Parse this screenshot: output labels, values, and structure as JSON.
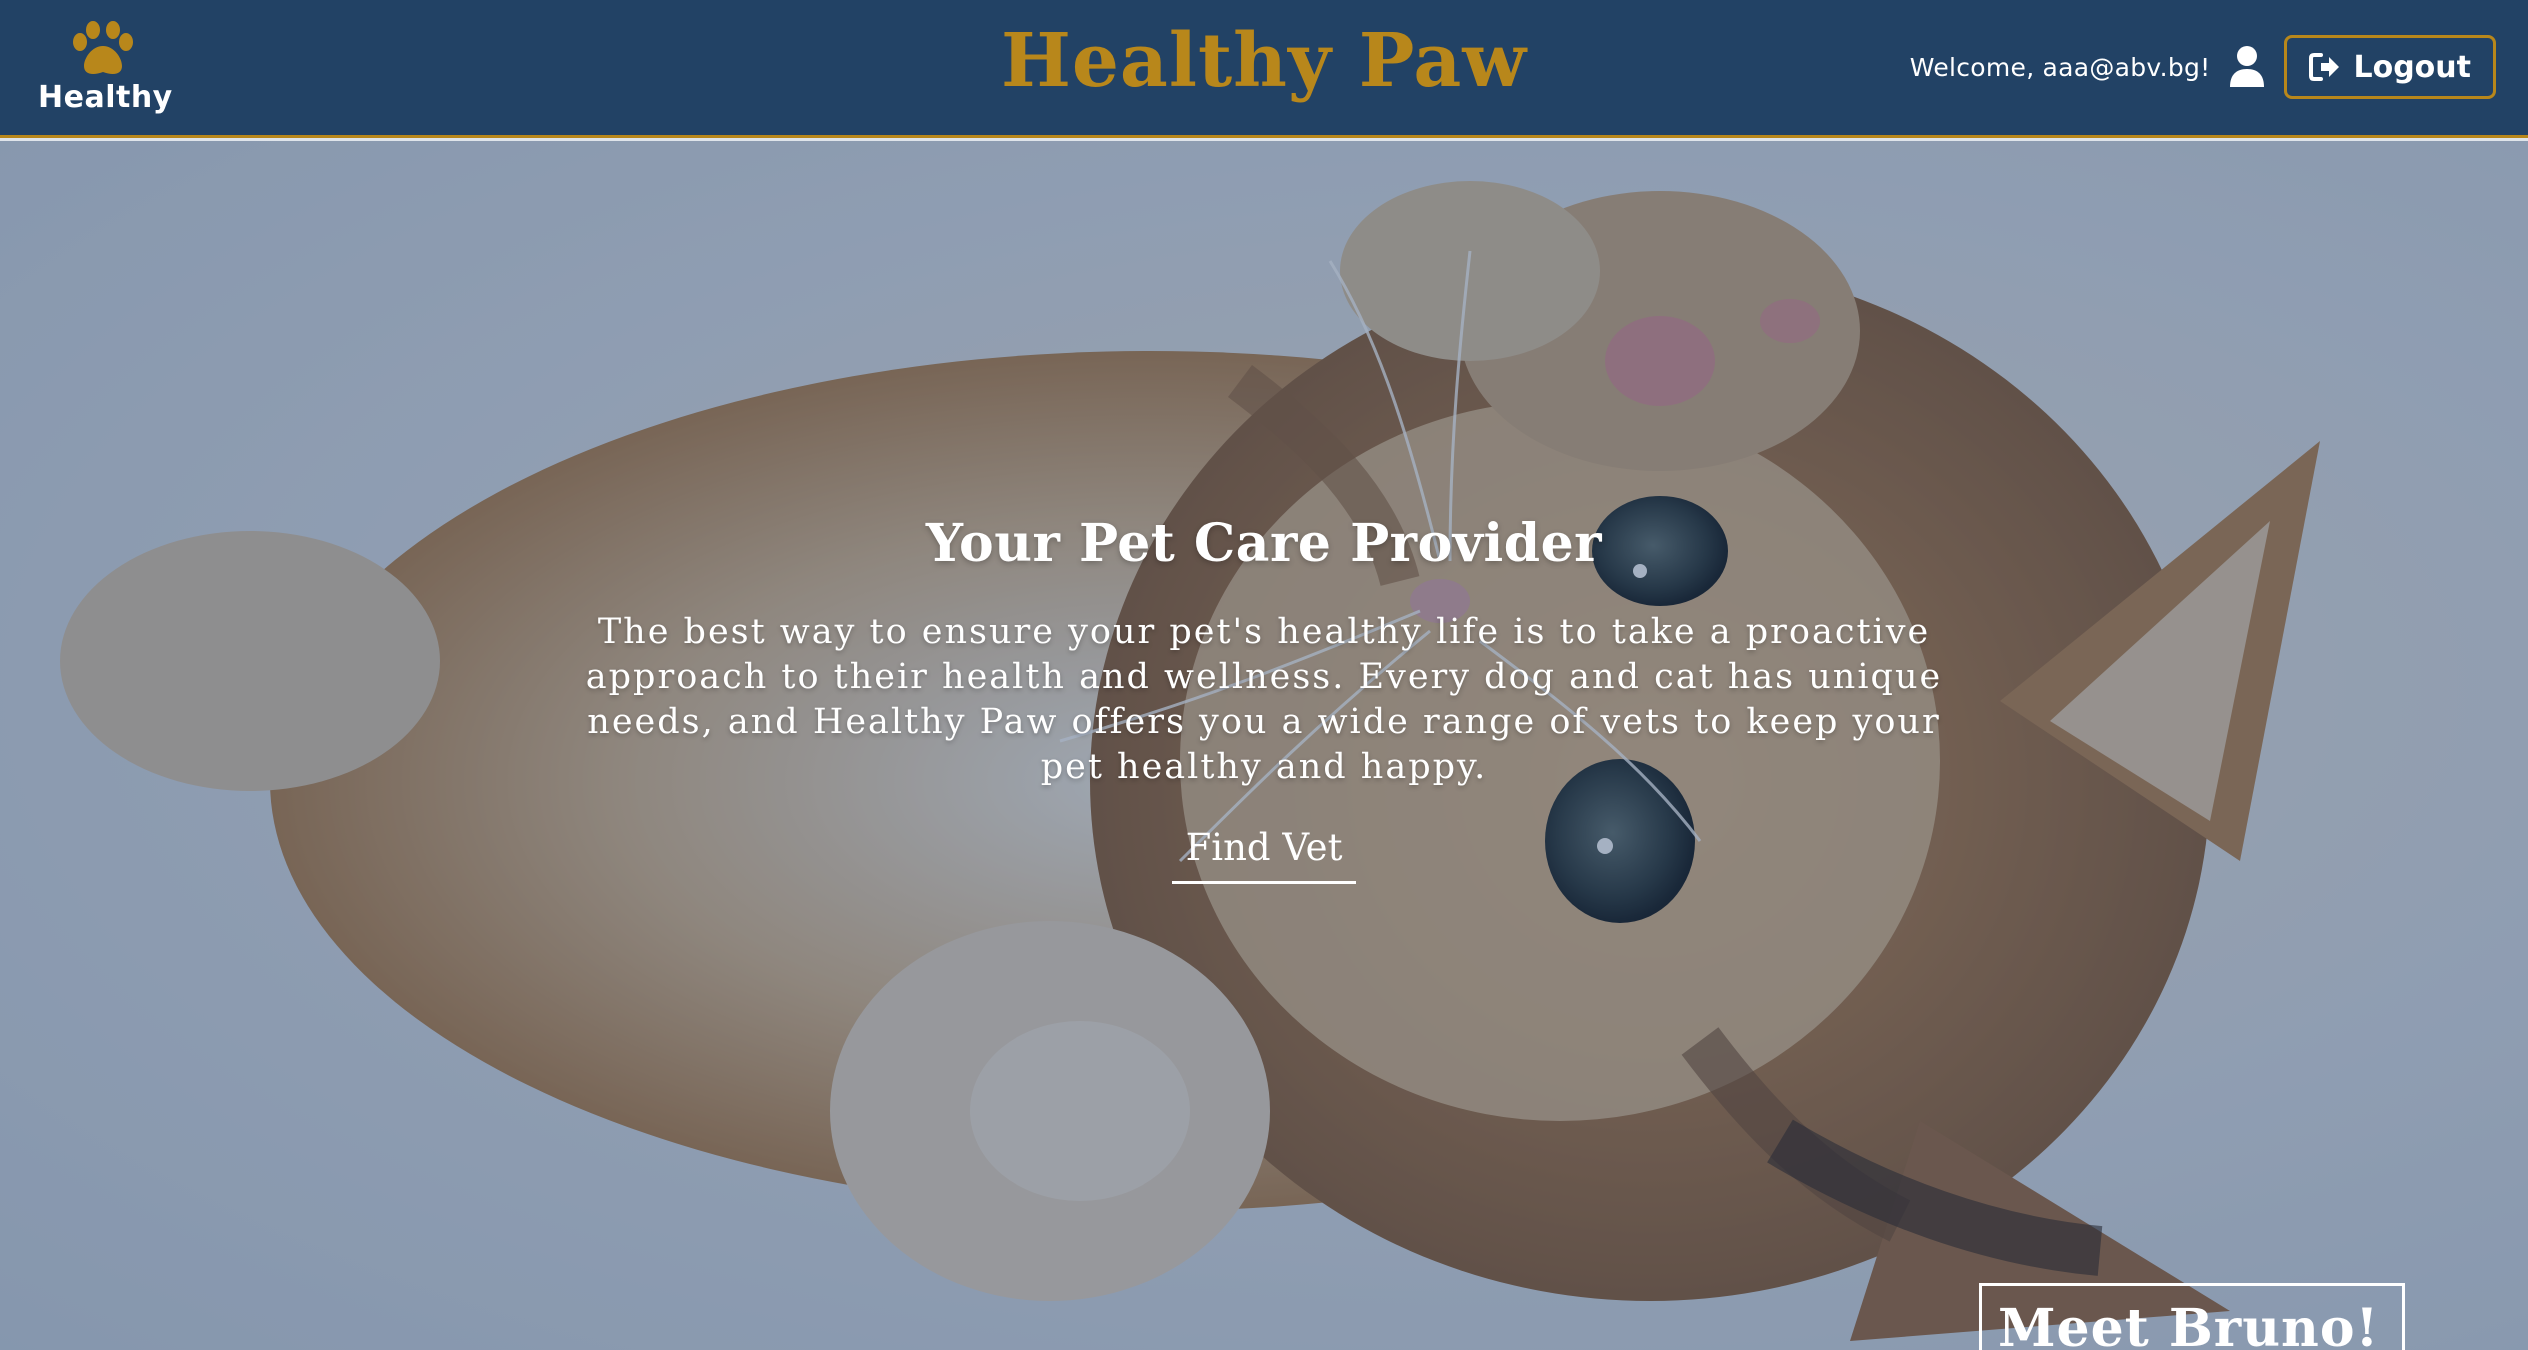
{
  "header": {
    "brand_label": "Healthy",
    "site_title": "Healthy Paw",
    "welcome_text": "Welcome,",
    "user_email": "aaa@abv.bg!",
    "logout_label": "Logout"
  },
  "hero": {
    "title": "Your Pet Care Provider",
    "text": "The best way to ensure your pet's healthy life is to take a proactive approach to their health and wellness. Every dog and cat has unique needs, and Healthy Paw offers you a wide range of vets to keep your pet healthy and happy.",
    "cta_label": "Find Vet",
    "meet_label": "Meet Bruno!"
  },
  "colors": {
    "header_bg": "#224265",
    "accent_gold": "#b8871b",
    "text_white": "#ffffff"
  },
  "icons": {
    "brand": "paw-icon",
    "user": "user-icon",
    "logout": "sign-out-icon"
  }
}
